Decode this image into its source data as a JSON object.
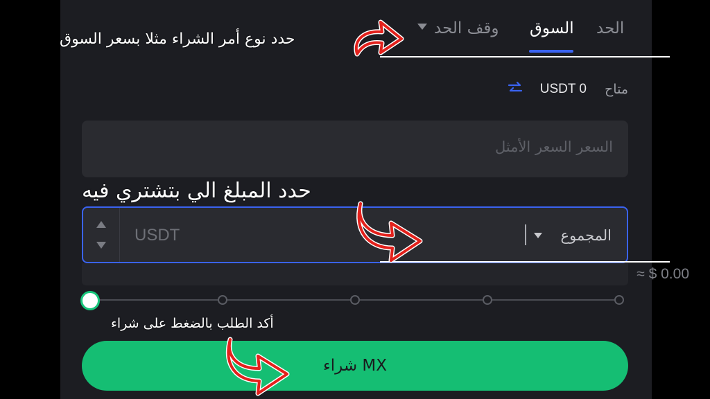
{
  "tabs": {
    "limit": "الحد",
    "market": "السوق",
    "stop_limit": "وقف الحد"
  },
  "available": {
    "label": "متاح",
    "value": "USDT 0"
  },
  "price_field": {
    "placeholder": "السعر السعر الأمثل"
  },
  "total_field": {
    "currency": "USDT",
    "select_label": "المجموع"
  },
  "estimate": "≈ $ 0.00",
  "slider": {
    "value_percent": 0
  },
  "buy_button": {
    "label": "شراء MX"
  },
  "annotations": {
    "order_type": "حدد نوع أمر الشراء مثلا بسعر السوق",
    "amount": "حدد المبلغ الي بتشتري فيه",
    "confirm": "أكد الطلب بالضغط على شراء"
  },
  "colors": {
    "accent_blue": "#3a63f0",
    "buy_green": "#15be73",
    "annotation_red": "#e3211c"
  }
}
